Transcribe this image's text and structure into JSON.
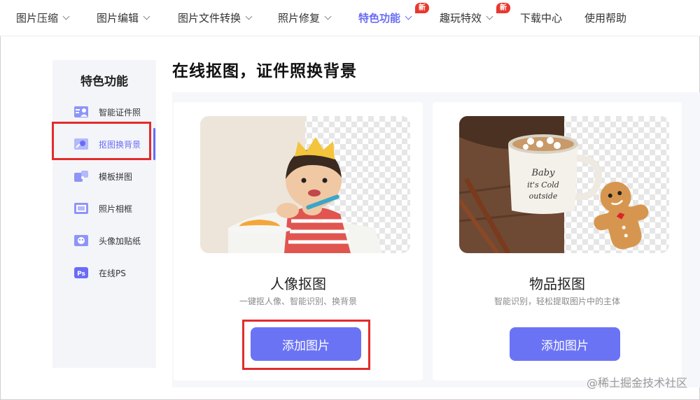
{
  "nav": {
    "items": [
      {
        "label": "图片压缩",
        "has_dropdown": true
      },
      {
        "label": "图片编辑",
        "has_dropdown": true
      },
      {
        "label": "图片文件转换",
        "has_dropdown": true
      },
      {
        "label": "照片修复",
        "has_dropdown": true
      },
      {
        "label": "特色功能",
        "has_dropdown": true,
        "active": true,
        "badge": "新"
      },
      {
        "label": "趣玩特效",
        "has_dropdown": true,
        "badge": "新"
      },
      {
        "label": "下载中心",
        "has_dropdown": false
      },
      {
        "label": "使用帮助",
        "has_dropdown": false
      }
    ]
  },
  "sidebar": {
    "title": "特色功能",
    "items": [
      {
        "label": "智能证件照",
        "icon": "id-photo-icon"
      },
      {
        "label": "抠图换背景",
        "icon": "cutout-icon",
        "active": true
      },
      {
        "label": "模板拼图",
        "icon": "puzzle-icon"
      },
      {
        "label": "照片相框",
        "icon": "photo-frame-icon"
      },
      {
        "label": "头像加贴纸",
        "icon": "sticker-icon"
      },
      {
        "label": "在线PS",
        "icon": "ps-icon"
      }
    ]
  },
  "main": {
    "title": "在线抠图，证件照换背景",
    "cards": [
      {
        "title": "人像抠图",
        "subtitle": "一键抠人像、智能识别、换背景",
        "button": "添加图片"
      },
      {
        "title": "物品抠图",
        "subtitle": "智能识别，轻松提取图片中的主体",
        "button": "添加图片"
      }
    ]
  },
  "watermark": "@稀土掘金技术社区",
  "colors": {
    "accent": "#6a6cf5",
    "button": "#6b73f5",
    "badge": "#e8382c",
    "highlight": "#e32b2b"
  }
}
